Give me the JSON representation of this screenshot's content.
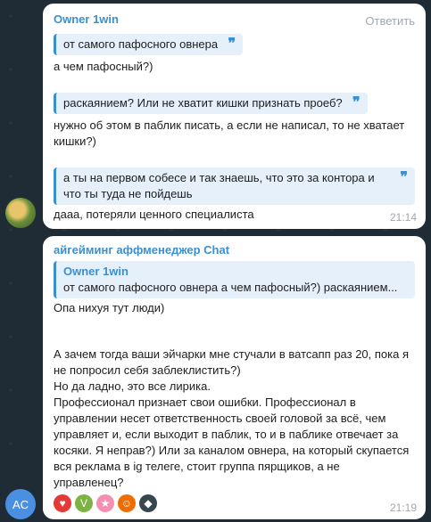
{
  "message1": {
    "sender": "Owner 1win",
    "reply_label": "Ответить",
    "quote1": "от самого пафосного овнера",
    "text1": "а чем пафосный?)",
    "quote2": "раскаянием? Или не хватит кишки признать проеб?",
    "text2": "нужно об этом в паблик писать, а если не написал, то не хватает кишки?)",
    "quote3": "а ты на первом собесе и так знаешь, что это за контора и что ты туда не пойдешь",
    "text3": "дааа, потеряли ценного специалиста",
    "time": "21:14",
    "quote_mark": "❞"
  },
  "message2": {
    "sender": "айгейминг аффменеджер Chat",
    "reply_quote_sender": "Owner 1win",
    "reply_quote_text": "от самого пафосного овнера а чем пафосный?)  раскаянием...",
    "text_line1": "Опа нихуя тут люди)",
    "text_block": "А зачем тогда ваши эйчарки мне стучали в ватсапп раз 20, пока я не попросил себя заблеклистить?)\nНо да ладно, это все лирика.\nПрофессионал признает свои ошибки. Профессионал в управлении несет ответственность своей головой за всё, чем управляет и, если выходит в паблик, то и в паблике отвечает за косяки. Я неправ?) Или за каналом овнера, на который скупается вся реклама в ig телеге, стоит группа пярщиков, а не управленец?",
    "time": "21:19",
    "avatar_initials": "AC",
    "reactions": [
      {
        "name": "heart-reaction",
        "glyph": "♥",
        "color": "#e53935"
      },
      {
        "name": "avatar-reaction-1",
        "glyph": "V",
        "color": "#7cb342"
      },
      {
        "name": "avatar-reaction-2",
        "glyph": "★",
        "color": "#f48fb1"
      },
      {
        "name": "avatar-reaction-3",
        "glyph": "☺",
        "color": "#ef6c00"
      },
      {
        "name": "avatar-reaction-4",
        "glyph": "◆",
        "color": "#37474f"
      }
    ]
  }
}
